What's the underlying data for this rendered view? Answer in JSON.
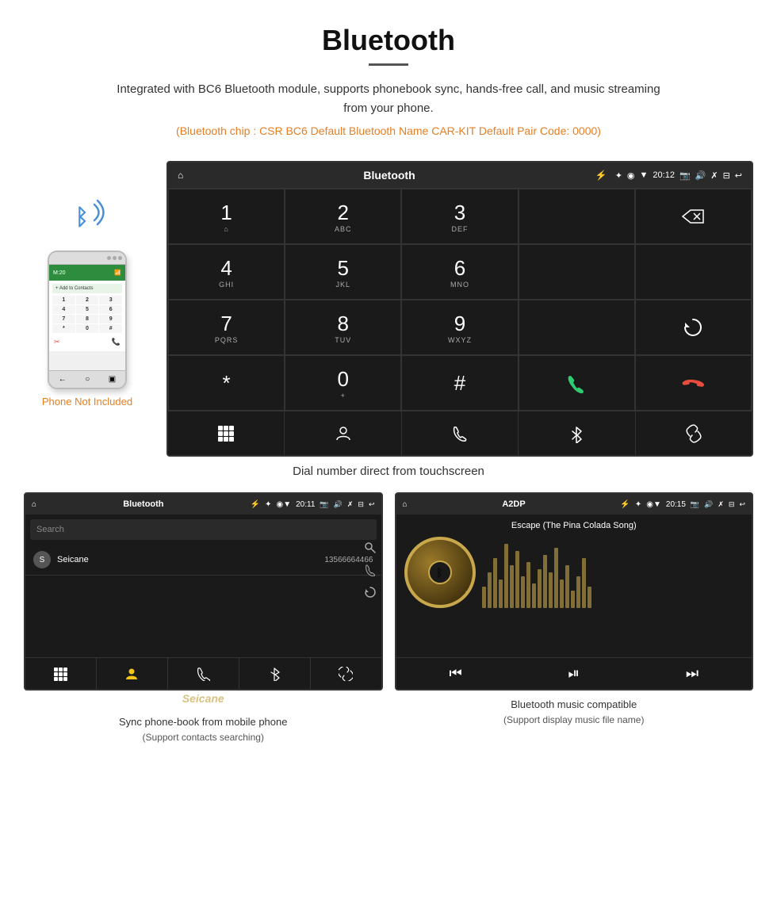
{
  "header": {
    "title": "Bluetooth",
    "description": "Integrated with BC6 Bluetooth module, supports phonebook sync, hands-free call, and music streaming from your phone.",
    "specs": "(Bluetooth chip : CSR BC6    Default Bluetooth Name CAR-KIT    Default Pair Code: 0000)"
  },
  "phone_label": "Phone Not Included",
  "dialpad_screen": {
    "status_bar": {
      "home": "⌂",
      "title": "Bluetooth",
      "usb": "⚡",
      "time": "20:12",
      "icons": "✦ ◉ ▼ ⊡ ⊟ ↩"
    },
    "keys": [
      {
        "num": "1",
        "sub": "⌂"
      },
      {
        "num": "2",
        "sub": "ABC"
      },
      {
        "num": "3",
        "sub": "DEF"
      },
      {
        "num": "",
        "sub": ""
      },
      {
        "num": "⌫",
        "sub": ""
      },
      {
        "num": "4",
        "sub": "GHI"
      },
      {
        "num": "5",
        "sub": "JKL"
      },
      {
        "num": "6",
        "sub": "MNO"
      },
      {
        "num": "",
        "sub": ""
      },
      {
        "num": "",
        "sub": ""
      },
      {
        "num": "7",
        "sub": "PQRS"
      },
      {
        "num": "8",
        "sub": "TUV"
      },
      {
        "num": "9",
        "sub": "WXYZ"
      },
      {
        "num": "",
        "sub": ""
      },
      {
        "num": "↻",
        "sub": ""
      },
      {
        "num": "*",
        "sub": ""
      },
      {
        "num": "0",
        "sub": "+"
      },
      {
        "num": "#",
        "sub": ""
      },
      {
        "num": "📞",
        "sub": "green"
      },
      {
        "num": "📞",
        "sub": "red"
      }
    ],
    "nav_icons": [
      "⊞",
      "👤",
      "📞",
      "✦",
      "🔗"
    ]
  },
  "dial_caption": "Dial number direct from touchscreen",
  "phonebook_screen": {
    "status_bar": {
      "title": "Bluetooth"
    },
    "search_placeholder": "Search",
    "contact": {
      "initial": "S",
      "name": "Seicane",
      "number": "13566664466"
    },
    "nav_icons": [
      "⊞",
      "👤",
      "📞",
      "✦",
      "🔗"
    ]
  },
  "music_screen": {
    "status_bar": {
      "title": "A2DP"
    },
    "song_title": "Escape (The Pina Colada Song)",
    "controls": [
      "⏮",
      "⏯",
      "⏭"
    ]
  },
  "captions": {
    "phonebook": "Sync phone-book from mobile phone",
    "phonebook_sub": "(Support contacts searching)",
    "music": "Bluetooth music compatible",
    "music_sub": "(Support display music file name)"
  }
}
